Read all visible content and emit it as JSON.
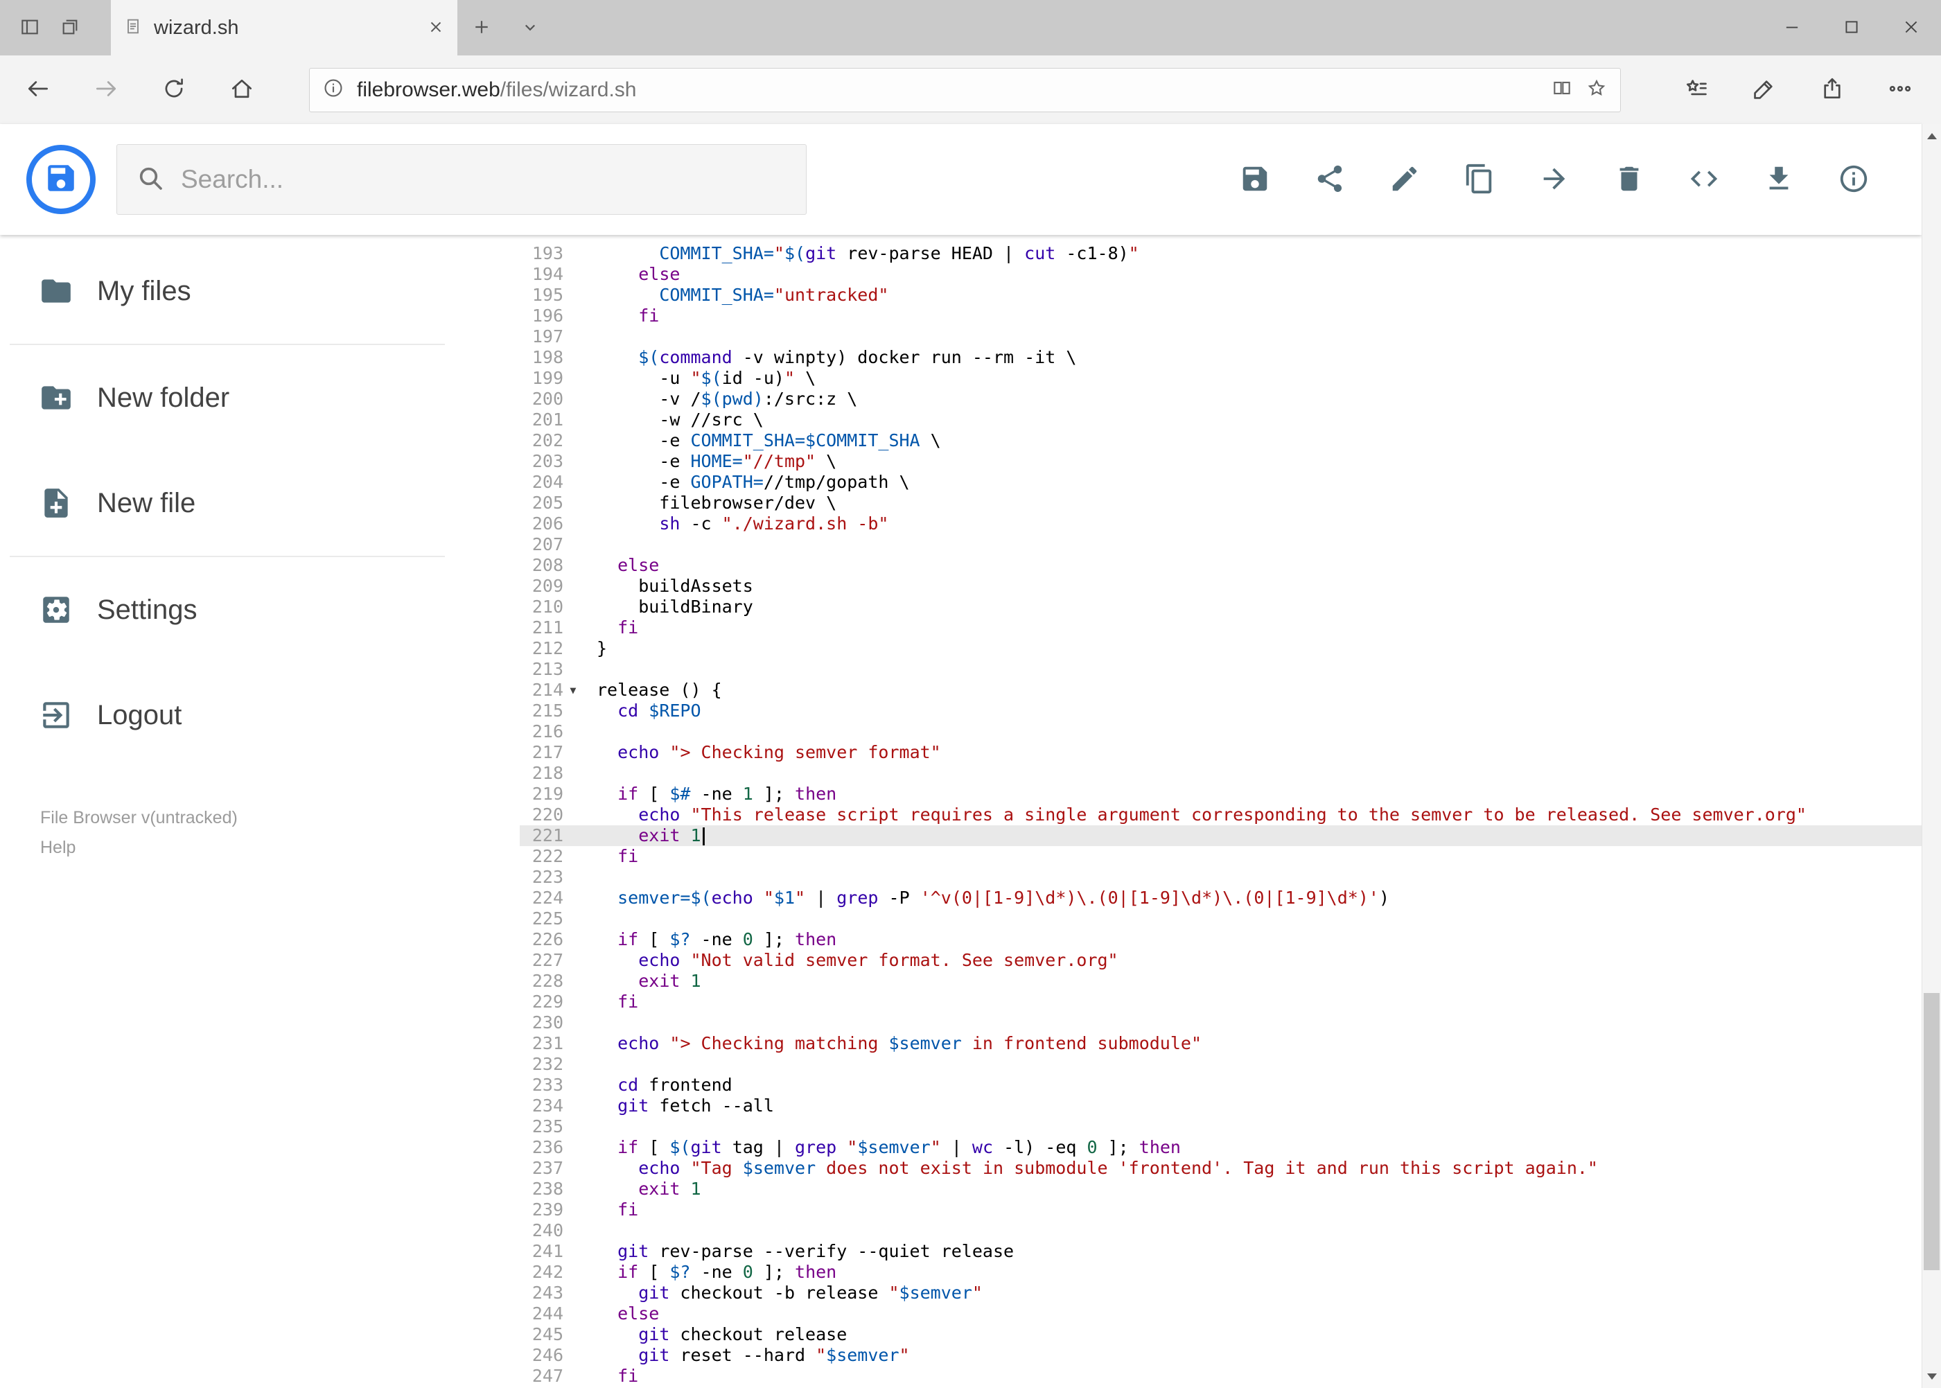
{
  "browser": {
    "tab_title": "wizard.sh",
    "url_domain": "filebrowser.web",
    "url_path": "/files/wizard.sh",
    "chrome_icons": [
      "set-tabs-aside-icon",
      "tab-preview-icon",
      "tab-favicon-document-icon",
      "tab-close-icon",
      "new-tab-icon",
      "tab-list-chevron-icon",
      "minimize-icon",
      "maximize-icon",
      "close-icon",
      "back-icon",
      "forward-icon",
      "refresh-icon",
      "home-icon",
      "page-info-icon",
      "reading-view-icon",
      "favorite-star-icon",
      "hub-icon",
      "web-note-icon",
      "share-icon",
      "more-icon"
    ]
  },
  "app": {
    "search_placeholder": "Search...",
    "toolbar_icons": [
      "save-icon",
      "share-icon",
      "rename-icon",
      "copy-icon",
      "move-icon",
      "delete-icon",
      "code-view-icon",
      "download-icon",
      "info-icon"
    ],
    "sidebar": {
      "items": [
        {
          "label": "My files",
          "icon": "folder-icon"
        },
        {
          "label": "New folder",
          "icon": "new-folder-icon"
        },
        {
          "label": "New file",
          "icon": "new-file-icon"
        },
        {
          "label": "Settings",
          "icon": "settings-icon"
        },
        {
          "label": "Logout",
          "icon": "logout-icon"
        }
      ],
      "divider_after": [
        0,
        2
      ],
      "footer_version": "File Browser v(untracked)",
      "footer_help": "Help"
    }
  },
  "colors": {
    "logo_blue": "#2a7cf0",
    "icon_slate": "#546e7a",
    "active_line_bg": "#e9e9e9",
    "line_number_gray": "#9e9e9e"
  },
  "editor": {
    "first_line": 193,
    "last_line": 247,
    "active_line": 221,
    "cursor_line": 221,
    "fold_marker_line": 214,
    "token_colors": {
      "p": "#000000",
      "kw": "#770088",
      "bi": "#3300aa",
      "v": "#0055aa",
      "s": "#aa1111",
      "n": "#116644"
    },
    "lines": [
      {
        "n": 193,
        "t": [
          [
            "p",
            "      "
          ],
          [
            "v",
            "COMMIT_SHA="
          ],
          [
            "s",
            "\""
          ],
          [
            "v",
            "$("
          ],
          [
            "bi",
            "git"
          ],
          [
            "p",
            " rev-parse HEAD | "
          ],
          [
            "bi",
            "cut"
          ],
          [
            "p",
            " -c1-8)"
          ],
          [
            "s",
            "\""
          ]
        ]
      },
      {
        "n": 194,
        "t": [
          [
            "p",
            "    "
          ],
          [
            "kw",
            "else"
          ]
        ]
      },
      {
        "n": 195,
        "t": [
          [
            "p",
            "      "
          ],
          [
            "v",
            "COMMIT_SHA="
          ],
          [
            "s",
            "\"untracked\""
          ]
        ]
      },
      {
        "n": 196,
        "t": [
          [
            "p",
            "    "
          ],
          [
            "kw",
            "fi"
          ]
        ]
      },
      {
        "n": 197,
        "t": []
      },
      {
        "n": 198,
        "t": [
          [
            "p",
            "    "
          ],
          [
            "v",
            "$("
          ],
          [
            "bi",
            "command"
          ],
          [
            "p",
            " -v winpty) docker run --rm -it \\"
          ]
        ]
      },
      {
        "n": 199,
        "t": [
          [
            "p",
            "      -u "
          ],
          [
            "s",
            "\""
          ],
          [
            "v",
            "$("
          ],
          [
            "p",
            "id -u)"
          ],
          [
            "s",
            "\""
          ],
          [
            "p",
            " \\"
          ]
        ]
      },
      {
        "n": 200,
        "t": [
          [
            "p",
            "      -v /"
          ],
          [
            "v",
            "$(pwd)"
          ],
          [
            "p",
            ":/src:z \\"
          ]
        ]
      },
      {
        "n": 201,
        "t": [
          [
            "p",
            "      -w //src \\"
          ]
        ]
      },
      {
        "n": 202,
        "t": [
          [
            "p",
            "      -e "
          ],
          [
            "v",
            "COMMIT_SHA=$COMMIT_SHA"
          ],
          [
            "p",
            " \\"
          ]
        ]
      },
      {
        "n": 203,
        "t": [
          [
            "p",
            "      -e "
          ],
          [
            "v",
            "HOME="
          ],
          [
            "s",
            "\"//tmp\""
          ],
          [
            "p",
            " \\"
          ]
        ]
      },
      {
        "n": 204,
        "t": [
          [
            "p",
            "      -e "
          ],
          [
            "v",
            "GOPATH="
          ],
          [
            "p",
            "//tmp/gopath \\"
          ]
        ]
      },
      {
        "n": 205,
        "t": [
          [
            "p",
            "      filebrowser/dev \\"
          ]
        ]
      },
      {
        "n": 206,
        "t": [
          [
            "p",
            "      "
          ],
          [
            "bi",
            "sh"
          ],
          [
            "p",
            " -c "
          ],
          [
            "s",
            "\"./wizard.sh -b\""
          ]
        ]
      },
      {
        "n": 207,
        "t": []
      },
      {
        "n": 208,
        "t": [
          [
            "p",
            "  "
          ],
          [
            "kw",
            "else"
          ]
        ]
      },
      {
        "n": 209,
        "t": [
          [
            "p",
            "    buildAssets"
          ]
        ]
      },
      {
        "n": 210,
        "t": [
          [
            "p",
            "    buildBinary"
          ]
        ]
      },
      {
        "n": 211,
        "t": [
          [
            "p",
            "  "
          ],
          [
            "kw",
            "fi"
          ]
        ]
      },
      {
        "n": 212,
        "t": [
          [
            "p",
            "}"
          ]
        ]
      },
      {
        "n": 213,
        "t": []
      },
      {
        "n": 214,
        "t": [
          [
            "p",
            "release () {"
          ]
        ]
      },
      {
        "n": 215,
        "t": [
          [
            "p",
            "  "
          ],
          [
            "bi",
            "cd"
          ],
          [
            "p",
            " "
          ],
          [
            "v",
            "$REPO"
          ]
        ]
      },
      {
        "n": 216,
        "t": []
      },
      {
        "n": 217,
        "t": [
          [
            "p",
            "  "
          ],
          [
            "bi",
            "echo"
          ],
          [
            "p",
            " "
          ],
          [
            "s",
            "\"> Checking semver format\""
          ]
        ]
      },
      {
        "n": 218,
        "t": []
      },
      {
        "n": 219,
        "t": [
          [
            "p",
            "  "
          ],
          [
            "kw",
            "if"
          ],
          [
            "p",
            " [ "
          ],
          [
            "v",
            "$#"
          ],
          [
            "p",
            " -ne "
          ],
          [
            "n2",
            "1"
          ],
          [
            "p",
            " ]; "
          ],
          [
            "kw",
            "then"
          ]
        ]
      },
      {
        "n": 220,
        "t": [
          [
            "p",
            "    "
          ],
          [
            "bi",
            "echo"
          ],
          [
            "p",
            " "
          ],
          [
            "s",
            "\"This release script requires a single argument corresponding to the semver to be released. See semver.org\""
          ]
        ]
      },
      {
        "n": 221,
        "t": [
          [
            "p",
            "    "
          ],
          [
            "kw",
            "exit"
          ],
          [
            "p",
            " "
          ],
          [
            "n2",
            "1"
          ]
        ]
      },
      {
        "n": 222,
        "t": [
          [
            "p",
            "  "
          ],
          [
            "kw",
            "fi"
          ]
        ]
      },
      {
        "n": 223,
        "t": []
      },
      {
        "n": 224,
        "t": [
          [
            "p",
            "  "
          ],
          [
            "v",
            "semver="
          ],
          [
            "v",
            "$("
          ],
          [
            "bi",
            "echo"
          ],
          [
            "p",
            " "
          ],
          [
            "s",
            "\""
          ],
          [
            "v",
            "$1"
          ],
          [
            "s",
            "\""
          ],
          [
            "p",
            " | "
          ],
          [
            "bi",
            "grep"
          ],
          [
            "p",
            " -P "
          ],
          [
            "s",
            "'^v(0|[1-9]\\d*)\\.(0|[1-9]\\d*)\\.(0|[1-9]\\d*)'"
          ],
          [
            "p",
            ")"
          ]
        ]
      },
      {
        "n": 225,
        "t": []
      },
      {
        "n": 226,
        "t": [
          [
            "p",
            "  "
          ],
          [
            "kw",
            "if"
          ],
          [
            "p",
            " [ "
          ],
          [
            "v",
            "$?"
          ],
          [
            "p",
            " -ne "
          ],
          [
            "n2",
            "0"
          ],
          [
            "p",
            " ]; "
          ],
          [
            "kw",
            "then"
          ]
        ]
      },
      {
        "n": 227,
        "t": [
          [
            "p",
            "    "
          ],
          [
            "bi",
            "echo"
          ],
          [
            "p",
            " "
          ],
          [
            "s",
            "\"Not valid semver format. See semver.org\""
          ]
        ]
      },
      {
        "n": 228,
        "t": [
          [
            "p",
            "    "
          ],
          [
            "kw",
            "exit"
          ],
          [
            "p",
            " "
          ],
          [
            "n2",
            "1"
          ]
        ]
      },
      {
        "n": 229,
        "t": [
          [
            "p",
            "  "
          ],
          [
            "kw",
            "fi"
          ]
        ]
      },
      {
        "n": 230,
        "t": []
      },
      {
        "n": 231,
        "t": [
          [
            "p",
            "  "
          ],
          [
            "bi",
            "echo"
          ],
          [
            "p",
            " "
          ],
          [
            "s",
            "\"> Checking matching "
          ],
          [
            "v",
            "$semver"
          ],
          [
            "s",
            " in frontend submodule\""
          ]
        ]
      },
      {
        "n": 232,
        "t": []
      },
      {
        "n": 233,
        "t": [
          [
            "p",
            "  "
          ],
          [
            "bi",
            "cd"
          ],
          [
            "p",
            " frontend"
          ]
        ]
      },
      {
        "n": 234,
        "t": [
          [
            "p",
            "  "
          ],
          [
            "bi",
            "git"
          ],
          [
            "p",
            " fetch --all"
          ]
        ]
      },
      {
        "n": 235,
        "t": []
      },
      {
        "n": 236,
        "t": [
          [
            "p",
            "  "
          ],
          [
            "kw",
            "if"
          ],
          [
            "p",
            " [ "
          ],
          [
            "v",
            "$("
          ],
          [
            "bi",
            "git"
          ],
          [
            "p",
            " tag | "
          ],
          [
            "bi",
            "grep"
          ],
          [
            "p",
            " "
          ],
          [
            "s",
            "\""
          ],
          [
            "v",
            "$semver"
          ],
          [
            "s",
            "\""
          ],
          [
            "p",
            " | "
          ],
          [
            "bi",
            "wc"
          ],
          [
            "p",
            " -l) -eq "
          ],
          [
            "n2",
            "0"
          ],
          [
            "p",
            " ]; "
          ],
          [
            "kw",
            "then"
          ]
        ]
      },
      {
        "n": 237,
        "t": [
          [
            "p",
            "    "
          ],
          [
            "bi",
            "echo"
          ],
          [
            "p",
            " "
          ],
          [
            "s",
            "\"Tag "
          ],
          [
            "v",
            "$semver"
          ],
          [
            "s",
            " does not exist in submodule 'frontend'. Tag it and run this script again.\""
          ]
        ]
      },
      {
        "n": 238,
        "t": [
          [
            "p",
            "    "
          ],
          [
            "kw",
            "exit"
          ],
          [
            "p",
            " "
          ],
          [
            "n2",
            "1"
          ]
        ]
      },
      {
        "n": 239,
        "t": [
          [
            "p",
            "  "
          ],
          [
            "kw",
            "fi"
          ]
        ]
      },
      {
        "n": 240,
        "t": []
      },
      {
        "n": 241,
        "t": [
          [
            "p",
            "  "
          ],
          [
            "bi",
            "git"
          ],
          [
            "p",
            " rev-parse --verify --quiet release"
          ]
        ]
      },
      {
        "n": 242,
        "t": [
          [
            "p",
            "  "
          ],
          [
            "kw",
            "if"
          ],
          [
            "p",
            " [ "
          ],
          [
            "v",
            "$?"
          ],
          [
            "p",
            " -ne "
          ],
          [
            "n2",
            "0"
          ],
          [
            "p",
            " ]; "
          ],
          [
            "kw",
            "then"
          ]
        ]
      },
      {
        "n": 243,
        "t": [
          [
            "p",
            "    "
          ],
          [
            "bi",
            "git"
          ],
          [
            "p",
            " checkout -b release "
          ],
          [
            "s",
            "\""
          ],
          [
            "v",
            "$semver"
          ],
          [
            "s",
            "\""
          ]
        ]
      },
      {
        "n": 244,
        "t": [
          [
            "p",
            "  "
          ],
          [
            "kw",
            "else"
          ]
        ]
      },
      {
        "n": 245,
        "t": [
          [
            "p",
            "    "
          ],
          [
            "bi",
            "git"
          ],
          [
            "p",
            " checkout release"
          ]
        ]
      },
      {
        "n": 246,
        "t": [
          [
            "p",
            "    "
          ],
          [
            "bi",
            "git"
          ],
          [
            "p",
            " reset --hard "
          ],
          [
            "s",
            "\""
          ],
          [
            "v",
            "$semver"
          ],
          [
            "s",
            "\""
          ]
        ]
      },
      {
        "n": 247,
        "t": [
          [
            "p",
            "  "
          ],
          [
            "kw",
            "fi"
          ]
        ]
      }
    ]
  }
}
